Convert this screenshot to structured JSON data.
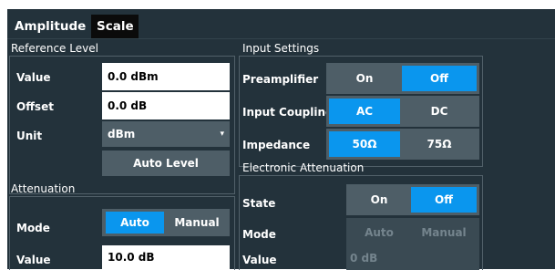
{
  "tabs": [
    {
      "label": "Amplitude",
      "active": true
    },
    {
      "label": "Scale",
      "active": false
    }
  ],
  "reference_level": {
    "title": "Reference Level",
    "value_label": "Value",
    "value": "0.0 dBm",
    "offset_label": "Offset",
    "offset": "0.0 dB",
    "unit_label": "Unit",
    "unit": "dBm",
    "auto_level_label": "Auto Level"
  },
  "attenuation": {
    "title": "Attenuation",
    "mode_label": "Mode",
    "mode_options": [
      "Auto",
      "Manual"
    ],
    "mode_selected": "Auto",
    "value_label": "Value",
    "value": "10.0 dB"
  },
  "input_settings": {
    "title": "Input Settings",
    "preamplifier_label": "Preamplifier",
    "preamplifier_options": [
      "On",
      "Off"
    ],
    "preamplifier_selected": "Off",
    "input_coupling_label": "Input Coupling",
    "input_coupling_options": [
      "AC",
      "DC"
    ],
    "input_coupling_selected": "AC",
    "impedance_label": "Impedance",
    "impedance_options": [
      "50Ω",
      "75Ω"
    ],
    "impedance_selected": "50Ω"
  },
  "electronic_attenuation": {
    "title": "Electronic Attenuation",
    "state_label": "State",
    "state_options": [
      "On",
      "Off"
    ],
    "state_selected": "Off",
    "mode_label": "Mode",
    "mode_options": [
      "Auto",
      "Manual"
    ],
    "value_label": "Value",
    "value": "0 dB"
  },
  "colors": {
    "panel_bg": "#23323b",
    "button_bg": "#4e5e67",
    "selected_blue": "#0a96ee",
    "field_bg": "#ffffff"
  }
}
